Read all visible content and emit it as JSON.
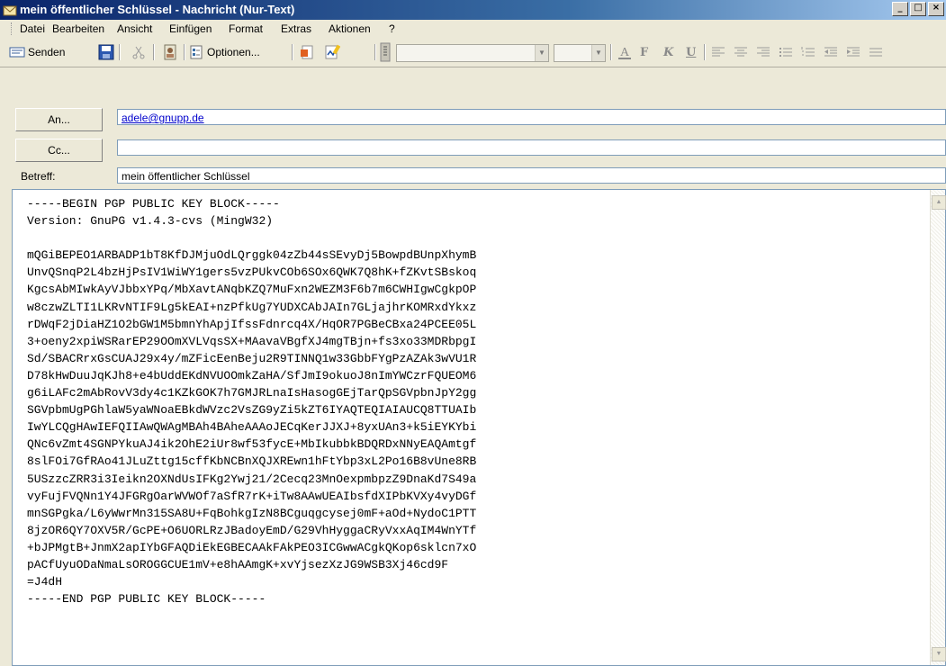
{
  "window": {
    "title": "mein öffentlicher Schlüssel - Nachricht (Nur-Text)",
    "buttons": [
      "_",
      "□",
      "×"
    ]
  },
  "menu": [
    "Datei",
    "Bearbeiten",
    "Ansicht",
    "Einfügen",
    "Format",
    "Extras",
    "Aktionen",
    "?"
  ],
  "toolbar": {
    "send_label": "Senden",
    "options_label": "Optionen...",
    "bold": "F",
    "italic": "K",
    "underline": "U"
  },
  "headers": {
    "to_button": "An...",
    "to_value": "adele@gnupp.de",
    "cc_button": "Cc...",
    "cc_value": "",
    "subject_label": "Betreff:",
    "subject_value": "mein öffentlicher Schlüssel"
  },
  "message": {
    "lines": [
      "-----BEGIN PGP PUBLIC KEY BLOCK-----",
      "Version: GnuPG v1.4.3-cvs (MingW32)",
      "",
      "mQGiBEPEO1ARBADP1bT8KfDJMjuOdLQrggk04zZb44sSEvyDj5BowpdBUnpXhymB",
      "UnvQSnqP2L4bzHjPsIV1WiWY1gers5vzPUkvCOb6SOx6QWK7Q8hK+fZKvtSBskoq",
      "KgcsAbMIwkAyVJbbxYPq/MbXavtANqbKZQ7MuFxn2WEZM3F6b7m6CWHIgwCgkpOP",
      "w8czwZLTI1LKRvNTIF9Lg5kEAI+nzPfkUg7YUDXCAbJAIn7GLjajhrKOMRxdYkxz",
      "rDWqF2jDiaHZ1O2bGW1M5bmnYhApjIfssFdnrcq4X/HqOR7PGBeCBxa24PCEE05L",
      "3+oeny2xpiWSRarEP29OOmXVLVqsSX+MAavaVBgfXJ4mgTBjn+fs3xo33MDRbpgI",
      "Sd/SBACRrxGsCUAJ29x4y/mZFicEenBeju2R9TINNQ1w33GbbFYgPzAZAk3wVU1R",
      "D78kHwDuuJqKJh8+e4bUddEKdNVUOOmkZaHA/SfJmI9okuoJ8nImYWCzrFQUEOM6",
      "g6iLAFc2mAbRovV3dy4c1KZkGOK7h7GMJRLnaIsHasogGEjTarQpSGVpbnJpY2gg",
      "SGVpbmUgPGhlaW5yaWNoaEBkdWVzc2VsZG9yZi5kZT6IYAQTEQIAIAUCQ8TTUAIb",
      "IwYLCQgHAwIEFQIIAwQWAgMBAh4BAheAAAoJECqKerJJXJ+8yxUAn3+k5iEYKYbi",
      "QNc6vZmt4SGNPYkuAJ4ik2OhE2iUr8wf53fycE+MbIkubbkBDQRDxNNyEAQAmtgf",
      "8slFOi7GfRAo41JLuZttg15cffKbNCBnXQJXREwn1hFtYbp3xL2Po16B8vUne8RB",
      "5USzzcZRR3i3Ieikn2OXNdUsIFKg2Ywj21/2Cecq23MnOexpmbpzZ9DnaKd7S49a",
      "vyFujFVQNn1Y4JFGRgOarWVWOf7aSfR7rK+iTw8AAwUEAIbsfdXIPbKVXy4vyDGf",
      "mnSGPgka/L6yWwrMn315SA8U+FqBohkgIzN8BCguqgcysej0mF+aOd+NydoC1PTT",
      "8jzOR6QY7OXV5R/GcPE+O6UORLRzJBadoyEmD/G29VhHyggaCRyVxxAqIM4WnYTf",
      "+bJPMgtB+JnmX2apIYbGFAQDiEkEGBECAAkFAkPEO3ICGwwACgkQKop6sklcn7xO",
      "pACfUyuODaNmaLsOROGGCUE1mV+e8hAAmgK+xvYjsezXzJG9WSB3Xj46cd9F",
      "=J4dH",
      "-----END PGP PUBLIC KEY BLOCK-----"
    ]
  }
}
